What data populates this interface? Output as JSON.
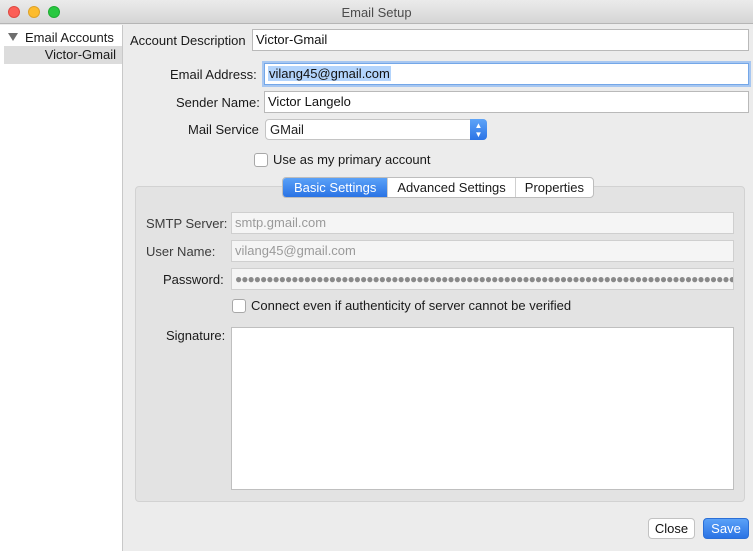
{
  "window": {
    "title": "Email Setup",
    "controls": [
      "close",
      "minimize",
      "zoom"
    ]
  },
  "sidebar": {
    "root_label": "Email Accounts",
    "accounts": [
      {
        "label": "Victor-Gmail",
        "selected": true
      }
    ]
  },
  "form": {
    "account_description": {
      "label": "Account Description",
      "value": "Victor-Gmail"
    },
    "email_address": {
      "label": "Email Address:",
      "value": "vilang45@gmail.com"
    },
    "sender_name": {
      "label": "Sender Name:",
      "value": "Victor Langelo"
    },
    "mail_service": {
      "label": "Mail Service",
      "value": "GMail"
    },
    "primary_account": {
      "label": "Use as my primary account",
      "checked": false
    }
  },
  "tabs": [
    {
      "label": "Basic Settings",
      "active": true
    },
    {
      "label": "Advanced Settings",
      "active": false
    },
    {
      "label": "Properties",
      "active": false
    }
  ],
  "basic_settings": {
    "smtp_server": {
      "label": "SMTP Server:",
      "value": "smtp.gmail.com"
    },
    "user_name": {
      "label": "User Name:",
      "value": "vilang45@gmail.com"
    },
    "password": {
      "label": "Password:",
      "value": "●●●●●●●●●●●●●●●●●●●●●●●●●●●●●●●●●●●●●●●●●●●●●●●●●●●●●●●●●●●●●●●●●●●●●●●●●●●●●●●●●●●●●●●●●●●●●●●●●●●"
    },
    "ignore_auth": {
      "label": "Connect even if authenticity of server cannot be verified",
      "checked": false
    },
    "signature": {
      "label": "Signature:",
      "value": ""
    }
  },
  "buttons": {
    "close_label": "Close",
    "save_label": "Save"
  },
  "colors": {
    "accent": "#2a73e5",
    "selection": "#b3d4fc",
    "sidebar_selected": "#dcdcdc"
  }
}
